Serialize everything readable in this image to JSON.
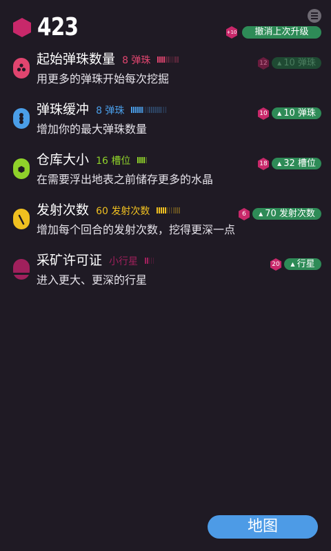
{
  "header": {
    "gem_count": "423",
    "undo_cost": "+10",
    "undo_label": "撤消上次升级",
    "menu_icon": "menu-icon"
  },
  "upgrades": [
    {
      "title": "起始弹珠数量",
      "stat": "8 弹珠",
      "description": "用更多的弹珠开始每次挖掘",
      "cost": "12",
      "button": "10 弹珠",
      "enabled": false,
      "color": "#e0456f",
      "level": 4,
      "max_level": 11
    },
    {
      "title": "弹珠缓冲",
      "stat": "8 弹珠",
      "description": "增加你的最大弹珠数量",
      "cost": "10",
      "button": "10 弹珠",
      "enabled": true,
      "color": "#4a9ee8",
      "level": 6,
      "max_level": 18
    },
    {
      "title": "仓库大小",
      "stat": "16 槽位",
      "description": "在需要浮出地表之前储存更多的水晶",
      "cost": "18",
      "button": "32 槽位",
      "enabled": true,
      "color": "#8fd22a",
      "level": 4,
      "max_level": 5
    },
    {
      "title": "发射次数",
      "stat": "60 发射次数",
      "description": "增加每个回合的发射次数，挖得更深一点",
      "cost": "6",
      "button": "70 发射次数",
      "enabled": true,
      "color": "#f0c020",
      "level": 5,
      "max_level": 12
    },
    {
      "title": "采矿许可证",
      "stat": "小行星",
      "description": "进入更大、更深的行星",
      "cost": "20",
      "button": "行星",
      "enabled": true,
      "color": "#a0205c",
      "level": 2,
      "max_level": 5
    }
  ],
  "footer": {
    "map_label": "地图"
  },
  "colors": {
    "background": "#1f1a24",
    "gem": "#c8286a",
    "button_green": "#2e8b57",
    "map_blue": "#4d9be6"
  }
}
